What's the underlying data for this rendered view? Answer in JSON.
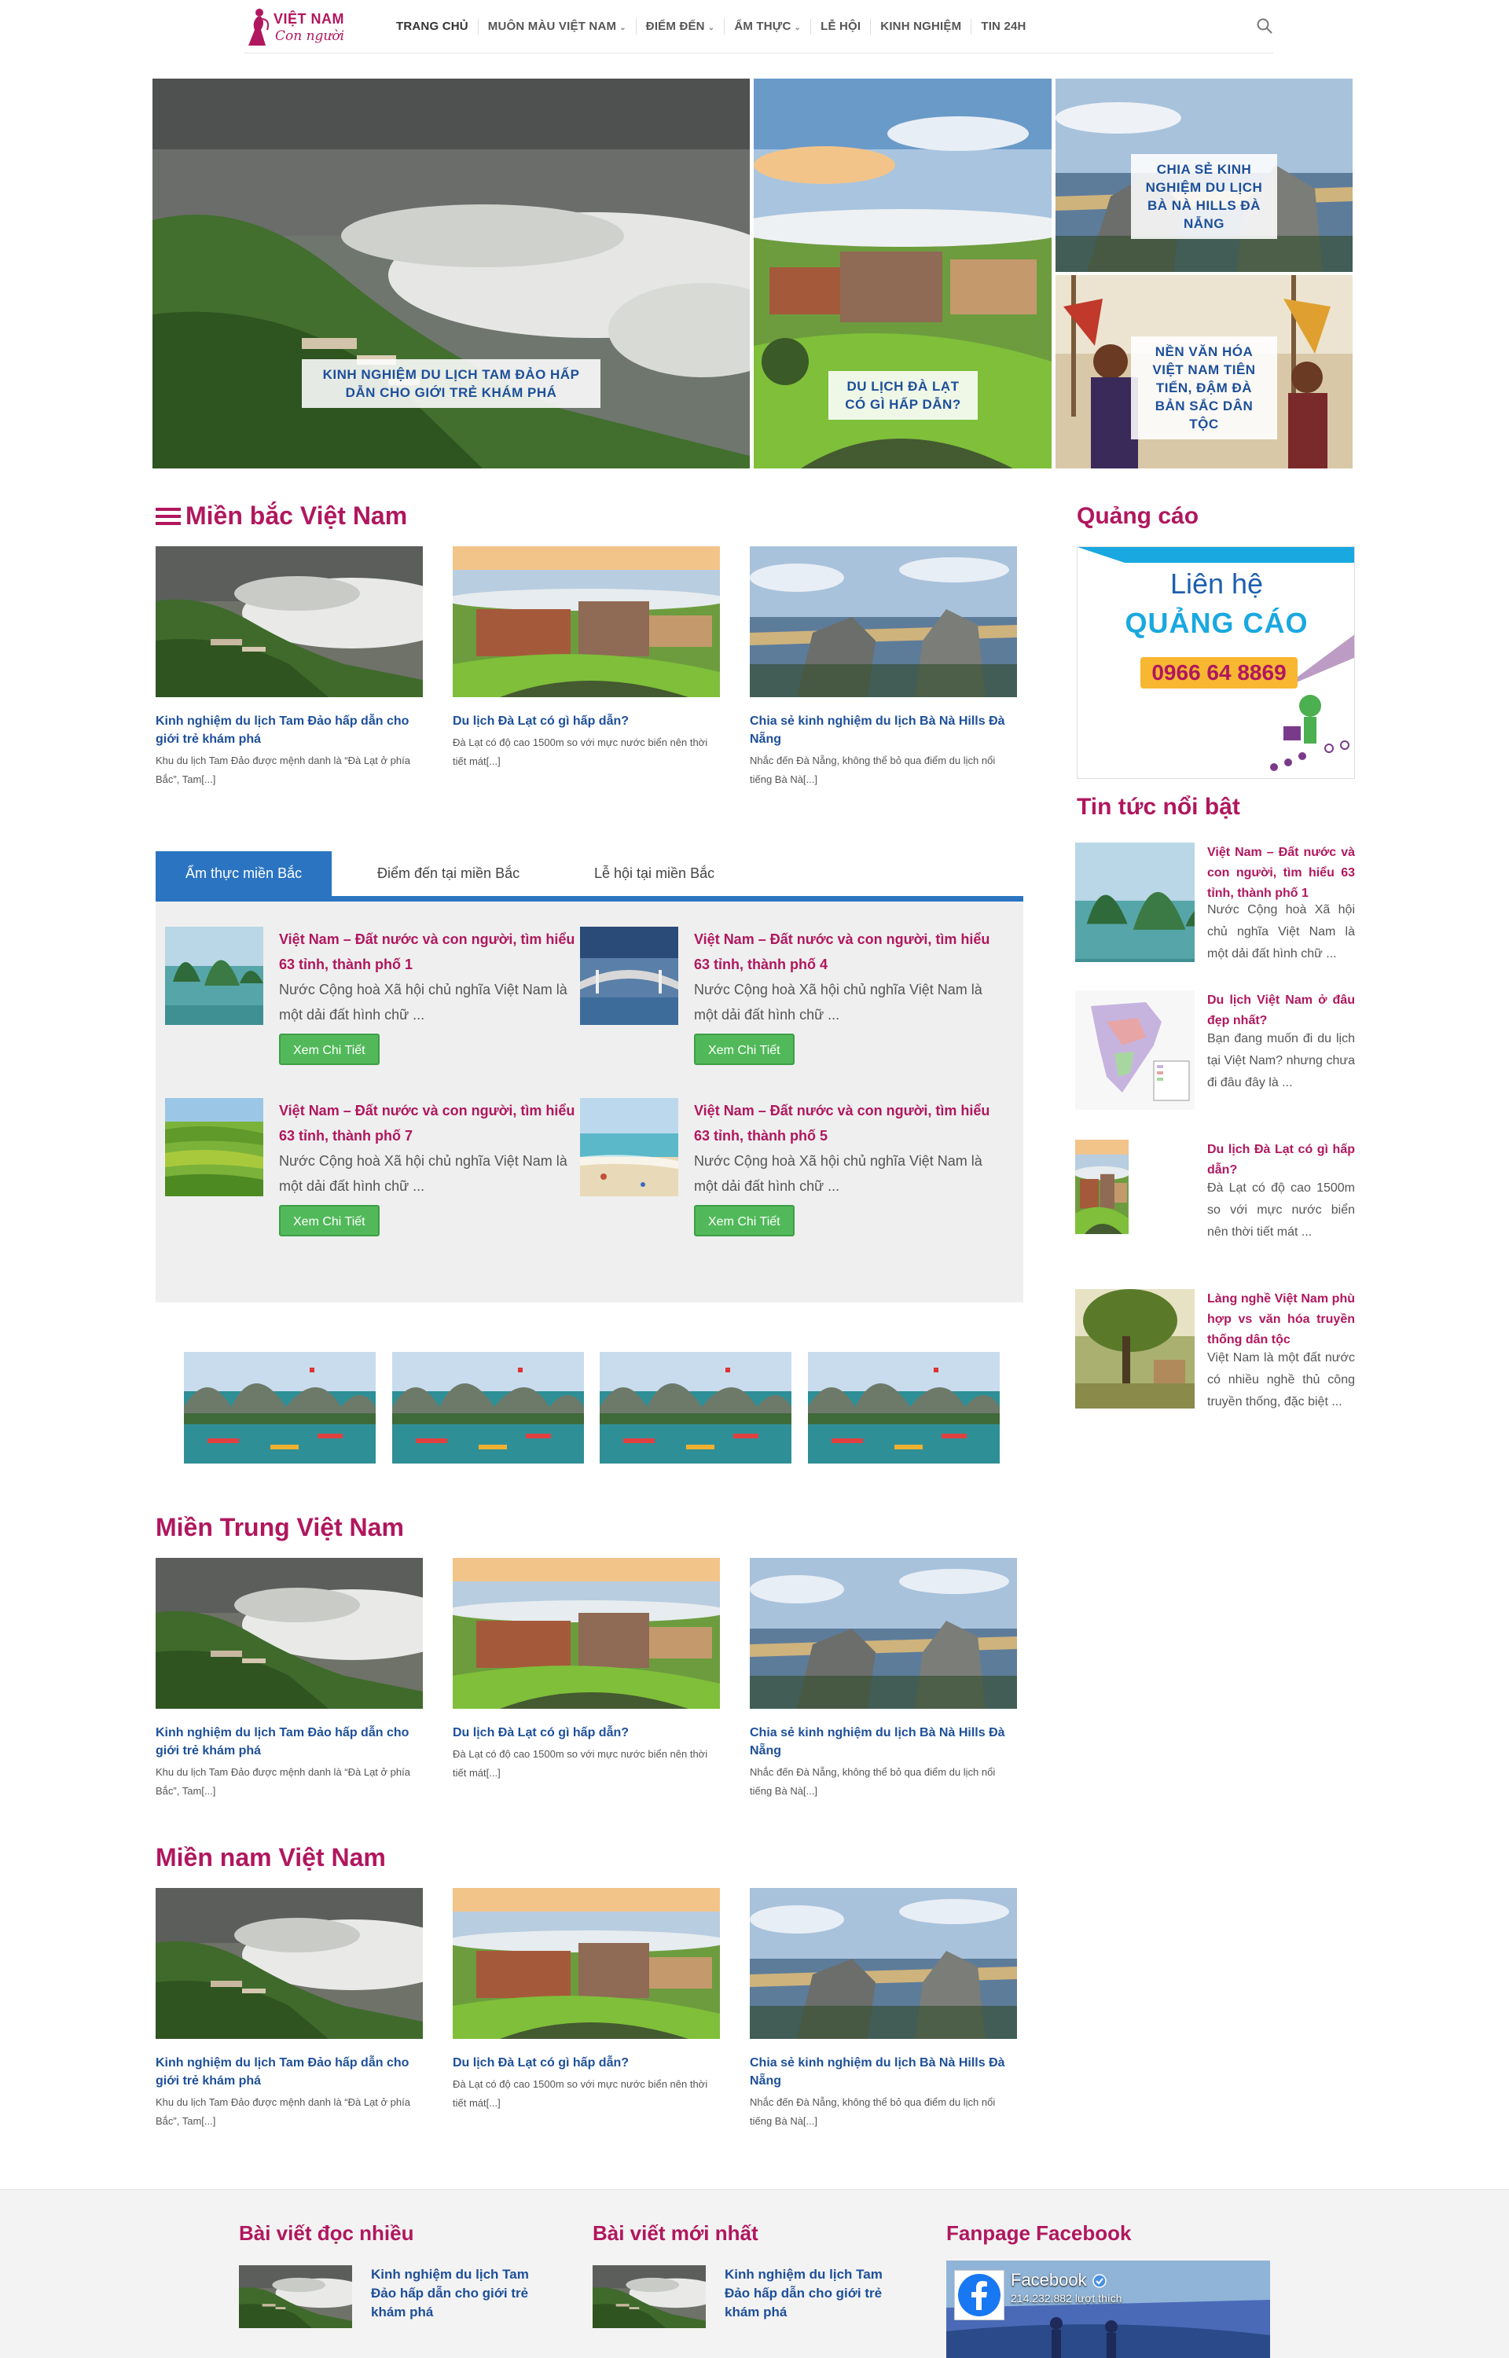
{
  "brand": {
    "name_line1": "VIỆT NAM",
    "name_line2": "Con người",
    "color": "#b0175e"
  },
  "nav": {
    "items": [
      {
        "label": "TRANG CHỦ",
        "dropdown": false
      },
      {
        "label": "MUÔN MÀU VIỆT NAM",
        "dropdown": true
      },
      {
        "label": "ĐIỂM ĐẾN",
        "dropdown": true
      },
      {
        "label": "ẨM THỰC",
        "dropdown": true
      },
      {
        "label": "LỄ HỘI",
        "dropdown": false
      },
      {
        "label": "KINH NGHIỆM",
        "dropdown": false
      },
      {
        "label": "TIN 24H",
        "dropdown": false
      }
    ],
    "search_icon": "search-icon"
  },
  "hero": [
    {
      "caption": "KINH NGHIỆM DU LỊCH TAM ĐẢO HẤP DẪN CHO GIỚI TRẺ KHÁM PHÁ"
    },
    {
      "caption": "DU LỊCH ĐÀ LẠT CÓ GÌ HẤP DẪN?"
    },
    {
      "caption": "CHIA SẺ KINH NGHIỆM DU LỊCH BÀ NÀ HILLS ĐÀ NẴNG"
    },
    {
      "caption": "NỀN VĂN HÓA VIỆT NAM TIÊN TIẾN, ĐẬM ĐÀ BẢN SẮC DÂN TỘC"
    }
  ],
  "articles": [
    {
      "title": "Kinh nghiệm du lịch Tam Đảo hấp dẫn cho giới trẻ khám phá",
      "excerpt": "Khu du lịch Tam Đảo được mệnh danh là “Đà Lạt ở phía Bắc”, Tam[...]"
    },
    {
      "title": "Du lịch Đà Lạt có gì hấp dẫn?",
      "excerpt": "Đà Lạt có độ cao 1500m so với mực nước biển nên thời tiết mát[...]"
    },
    {
      "title": "Chia sẻ kinh nghiệm du lịch Bà Nà Hills Đà Nẵng",
      "excerpt": "Nhắc đến Đà Nẵng, không thể bỏ qua điểm du lịch nổi tiếng Bà Nà[...]"
    }
  ],
  "sections": {
    "north": "Miền bắc Việt Nam",
    "central": "Miền Trung Việt Nam",
    "south": "Miền nam Việt Nam"
  },
  "tabs": {
    "labels": [
      "Ẩm thực miền Bắc",
      "Điểm đến tại miền Bắc",
      "Lễ hội tại miền Bắc"
    ],
    "items": [
      {
        "title": "Việt Nam – Đất nước và con người, tìm hiểu 63 tỉnh, thành phố 1",
        "excerpt": "Nước Cộng hoà Xã hội chủ nghĩa Việt Nam là một dải đất hình chữ ...",
        "button": "Xem Chi Tiết"
      },
      {
        "title": "Việt Nam – Đất nước và con người, tìm hiểu 63 tỉnh, thành phố 4",
        "excerpt": "Nước Cộng hoà Xã hội chủ nghĩa Việt Nam là một dải đất hình chữ ...",
        "button": "Xem Chi Tiết"
      },
      {
        "title": "Việt Nam – Đất nước và con người, tìm hiểu 63 tỉnh, thành phố 7",
        "excerpt": "Nước Cộng hoà Xã hội chủ nghĩa Việt Nam là một dải đất hình chữ ...",
        "button": "Xem Chi Tiết"
      },
      {
        "title": "Việt Nam – Đất nước và con người, tìm hiểu 63 tỉnh, thành phố 5",
        "excerpt": "Nước Cộng hoà Xã hội chủ nghĩa Việt Nam là một dải đất hình chữ ...",
        "button": "Xem Chi Tiết"
      }
    ]
  },
  "sidebar": {
    "ads_title": "Quảng cáo",
    "ad": {
      "line1": "Liên hệ",
      "line2": "QUẢNG CÁO",
      "phone": "0966 64 8869"
    },
    "news_title": "Tin tức nổi bật",
    "news": [
      {
        "title": "Việt Nam – Đất nước và con người, tìm hiểu 63 tỉnh, thành phố 1",
        "excerpt": "Nước Cộng hoà Xã hội chủ nghĩa Việt Nam là một dải đất hình chữ ..."
      },
      {
        "title": "Du lịch Việt Nam ở đâu đẹp nhất?",
        "excerpt": "Bạn đang muốn đi du lịch tại Việt Nam? nhưng chưa đi đâu đây là ..."
      },
      {
        "title": "Du lịch Đà Lạt có gì hấp dẫn?",
        "excerpt": "Đà Lạt có độ cao 1500m so với mực nước biển nên thời tiết mát ..."
      },
      {
        "title": "Làng nghề Việt Nam phù hợp vs văn hóa truyền thống dân tộc",
        "excerpt": "Việt Nam là một đất nước có nhiều nghề thủ công truyền thống, đặc biệt ..."
      }
    ]
  },
  "footer": {
    "popular_title": "Bài viết đọc nhiều",
    "latest_title": "Bài viết mới nhất",
    "fanpage_title": "Fanpage Facebook",
    "popular_item": "Kinh nghiệm du lịch Tam Đảo hấp dẫn cho giới trẻ khám phá",
    "latest_item": "Kinh nghiệm du lịch Tam Đảo hấp dẫn cho giới trẻ khám phá",
    "fb_name": "Facebook",
    "fb_likes": "214.232.882 lượt thích"
  }
}
